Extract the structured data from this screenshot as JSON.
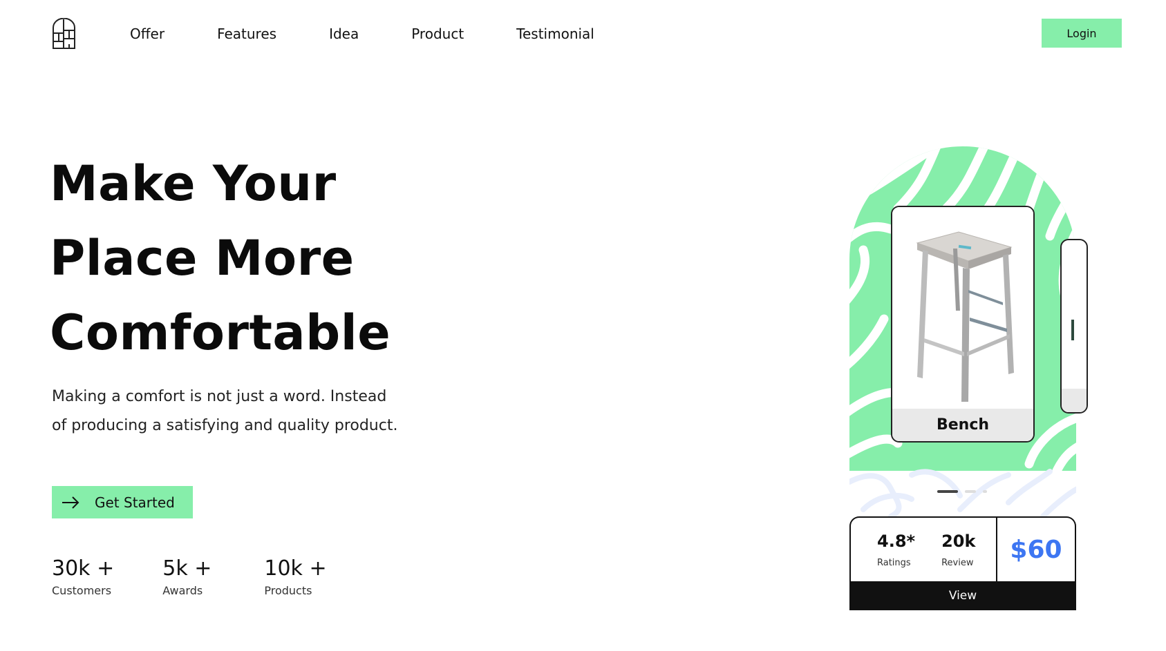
{
  "nav": {
    "logo_icon": "building-logo-icon",
    "items": [
      "Offer",
      "Features",
      "Idea",
      "Product",
      "Testimonial"
    ],
    "login_label": "Login"
  },
  "hero": {
    "title_lines": [
      "Make Your",
      "Place More",
      "Comfortable"
    ],
    "subtitle_lines": [
      "Making a comfort is not just a word. Instead",
      "of producing a satisfying and quality product."
    ],
    "cta_label": "Get Started",
    "cta_icon": "arrow-right-icon"
  },
  "stats": [
    {
      "value": "30k +",
      "label": "Customers"
    },
    {
      "value": "5k +",
      "label": "Awards"
    },
    {
      "value": "10k +",
      "label": "Products"
    }
  ],
  "product": {
    "name": "Bench",
    "image_icon": "bar-stool-image",
    "rating": "4.8*",
    "rating_label": "Ratings",
    "reviews": "20k",
    "reviews_label": "Review",
    "price": "$60",
    "view_label": "View",
    "carousel_pages": 3,
    "carousel_active": 1
  },
  "colors": {
    "accent": "#86eeaa",
    "price": "#3d76f2",
    "dark": "#111111"
  }
}
